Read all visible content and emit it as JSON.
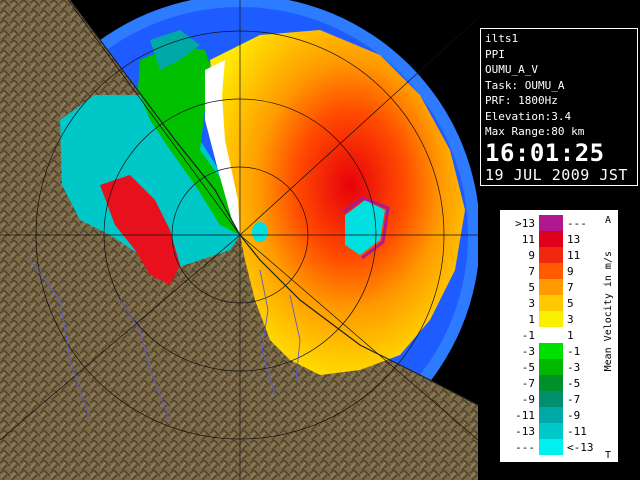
{
  "info": {
    "radar": "ilts1",
    "scan": "PPI",
    "product": "OUMU_A_V",
    "task": "Task: OUMU_A",
    "prf": "PRF: 1800Hz",
    "elevation": "Elevation:3.4",
    "max_range": "Max Range:80 km",
    "time": "16:01:25",
    "date": "19 JUL 2009 JST"
  },
  "legend": {
    "unit_label": "Mean Velocity in m/s",
    "top_marker": "A",
    "bottom_marker": "T",
    "rows": [
      {
        "lo": ">13",
        "hi": "---",
        "color": "#b0188f"
      },
      {
        "lo": "11",
        "hi": "13",
        "color": "#e0001c"
      },
      {
        "lo": "9",
        "hi": "11",
        "color": "#f0280e"
      },
      {
        "lo": "7",
        "hi": "9",
        "color": "#ff5a00"
      },
      {
        "lo": "5",
        "hi": "7",
        "color": "#ff9a00"
      },
      {
        "lo": "3",
        "hi": "5",
        "color": "#ffc800"
      },
      {
        "lo": "1",
        "hi": "3",
        "color": "#f8f000"
      },
      {
        "lo": "-1",
        "hi": "1",
        "color": "#ffffff"
      },
      {
        "lo": "-3",
        "hi": "-1",
        "color": "#00e000"
      },
      {
        "lo": "-5",
        "hi": "-3",
        "color": "#00b800"
      },
      {
        "lo": "-7",
        "hi": "-5",
        "color": "#009028"
      },
      {
        "lo": "-9",
        "hi": "-7",
        "color": "#009070"
      },
      {
        "lo": "-11",
        "hi": "-9",
        "color": "#00a8a8"
      },
      {
        "lo": "-13",
        "hi": "-11",
        "color": "#00c8c8"
      },
      {
        "lo": "---",
        "hi": "<-13",
        "color": "#00f0f0"
      }
    ]
  },
  "map": {
    "ocean_color": "#1e5cff",
    "range_outer_color": "#2d7bff",
    "land_color": "#7a6a4a"
  }
}
